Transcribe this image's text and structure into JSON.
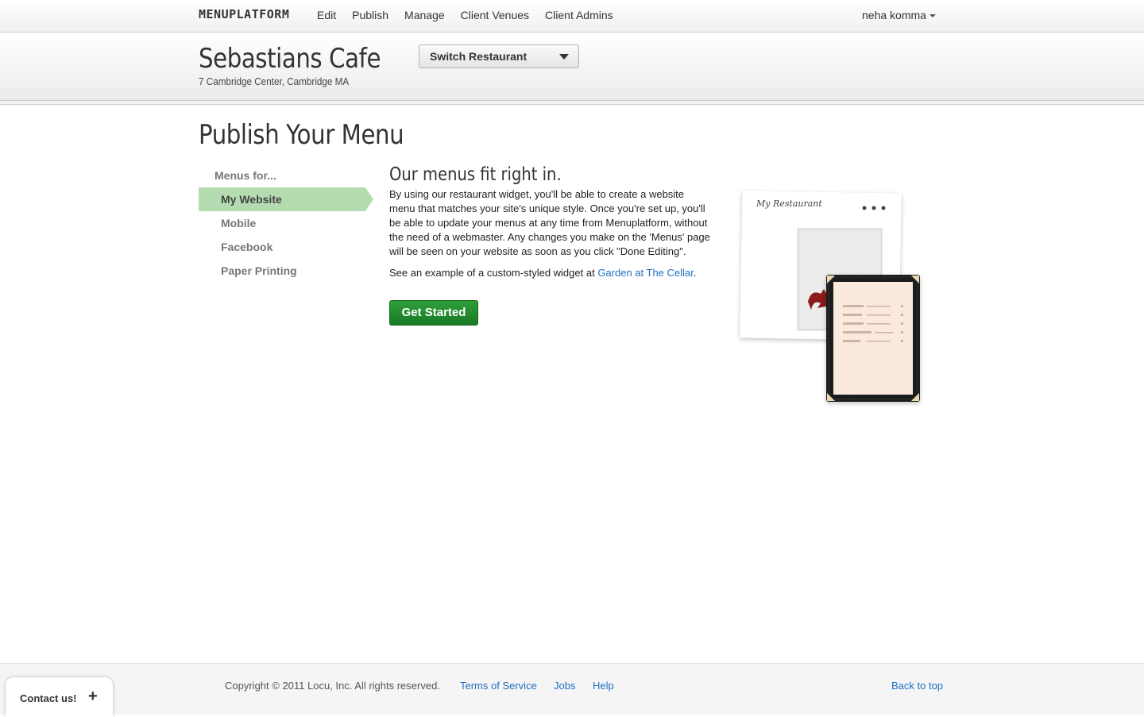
{
  "topnav": {
    "brand": "MENUPLATFORM",
    "links": [
      "Edit",
      "Publish",
      "Manage",
      "Client Venues",
      "Client Admins"
    ],
    "user": "neha komma"
  },
  "restaurant": {
    "name": "Sebastians Cafe",
    "address": "7 Cambridge Center, Cambridge MA",
    "switch_label": "Switch Restaurant"
  },
  "page": {
    "title": "Publish Your Menu"
  },
  "sidebar": {
    "heading": "Menus for...",
    "items": [
      {
        "label": "My Website",
        "active": true
      },
      {
        "label": "Mobile",
        "active": false
      },
      {
        "label": "Facebook",
        "active": false
      },
      {
        "label": "Paper Printing",
        "active": false
      }
    ]
  },
  "main": {
    "heading": "Our menus fit right in.",
    "description": "By using our restaurant widget, you'll be able to create a website menu that matches your site's unique style. Once you're set up, you'll be able to update your menus at any time from Menuplatform, without the need of a webmaster. Any changes you make on the 'Menus' page will be seen on your website as soon as you click \"Done Editing\".",
    "example_prefix": "See an example of a custom-styled widget at ",
    "example_link": "Garden at The Cellar",
    "example_suffix": ".",
    "cta": "Get Started"
  },
  "illustration": {
    "title": "My Restaurant"
  },
  "footer": {
    "copyright": "Copyright © 2011 Locu, Inc. All rights reserved.",
    "terms": "Terms of Service",
    "jobs": "Jobs",
    "help": "Help",
    "back_to_top": "Back to top",
    "contact": "Contact us!",
    "contact_plus": "+"
  },
  "colors": {
    "active_nav": "#b4dcb0",
    "button_green": "#1f8a2c",
    "link_blue": "#1e6fc2"
  }
}
